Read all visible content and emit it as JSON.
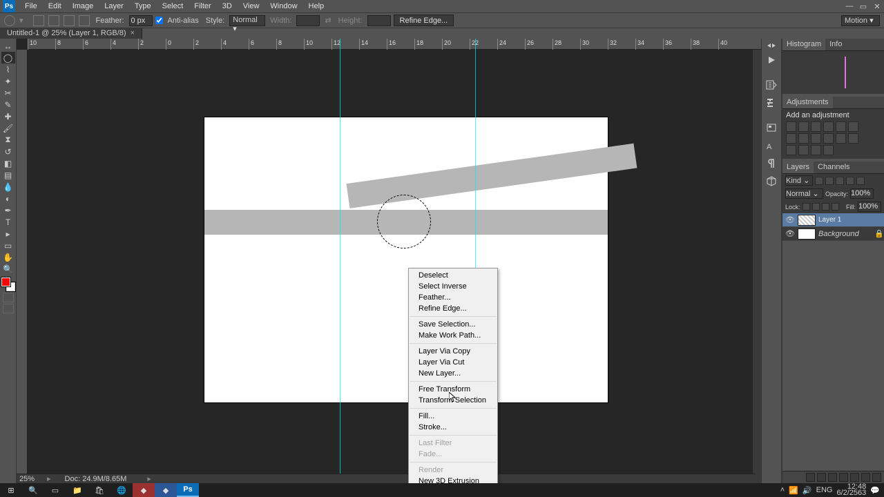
{
  "menubar": [
    "File",
    "Edit",
    "Image",
    "Layer",
    "Type",
    "Select",
    "Filter",
    "3D",
    "View",
    "Window",
    "Help"
  ],
  "optionsbar": {
    "feather_lbl": "Feather:",
    "feather_val": "0 px",
    "anti": "Anti-alias",
    "style": "Style:",
    "style_val": "Normal",
    "width_lbl": "Width:",
    "height_lbl": "Height:",
    "refine": "Refine Edge...",
    "workspace": "Motion"
  },
  "doctab": "Untitled-1 @ 25% (Layer 1, RGB/8)",
  "ruler_h": [
    "10",
    "8",
    "6",
    "4",
    "2",
    "0",
    "2",
    "4",
    "6",
    "8",
    "10",
    "12",
    "14",
    "16",
    "18",
    "20",
    "22",
    "24",
    "26",
    "28",
    "30",
    "32",
    "34",
    "36",
    "38",
    "40"
  ],
  "context": [
    {
      "t": "Deselect"
    },
    {
      "t": "Select Inverse"
    },
    {
      "t": "Feather..."
    },
    {
      "t": "Refine Edge..."
    },
    {
      "sep": true
    },
    {
      "t": "Save Selection..."
    },
    {
      "t": "Make Work Path..."
    },
    {
      "sep": true
    },
    {
      "t": "Layer Via Copy"
    },
    {
      "t": "Layer Via Cut"
    },
    {
      "t": "New Layer..."
    },
    {
      "sep": true
    },
    {
      "t": "Free Transform"
    },
    {
      "t": "Transform Selection"
    },
    {
      "sep": true
    },
    {
      "t": "Fill..."
    },
    {
      "t": "Stroke..."
    },
    {
      "sep": true
    },
    {
      "t": "Last Filter",
      "d": true
    },
    {
      "t": "Fade...",
      "d": true
    },
    {
      "sep": true
    },
    {
      "t": "Render",
      "d": true
    },
    {
      "t": "New 3D Extrusion"
    }
  ],
  "panels": {
    "histo_tabs": [
      "Histogram",
      "Info"
    ],
    "adj_tab": "Adjustments",
    "adj_title": "Add an adjustment",
    "lay_tabs": [
      "Layers",
      "Channels"
    ],
    "kind": "Kind",
    "normal": "Normal",
    "opacity_lbl": "Opacity:",
    "opacity_val": "100%",
    "lock_lbl": "Lock:",
    "fill_lbl": "Fill:",
    "fill_val": "100%",
    "layers": [
      {
        "name": "Layer 1",
        "sel": true
      },
      {
        "name": "Background",
        "locked": true,
        "italic": true
      }
    ]
  },
  "status": {
    "zoom": "25%",
    "doc": "Doc: 24.9M/8.65M"
  },
  "tray": {
    "lang": "ENG",
    "time": "12:48",
    "date": "6/2/2563"
  }
}
